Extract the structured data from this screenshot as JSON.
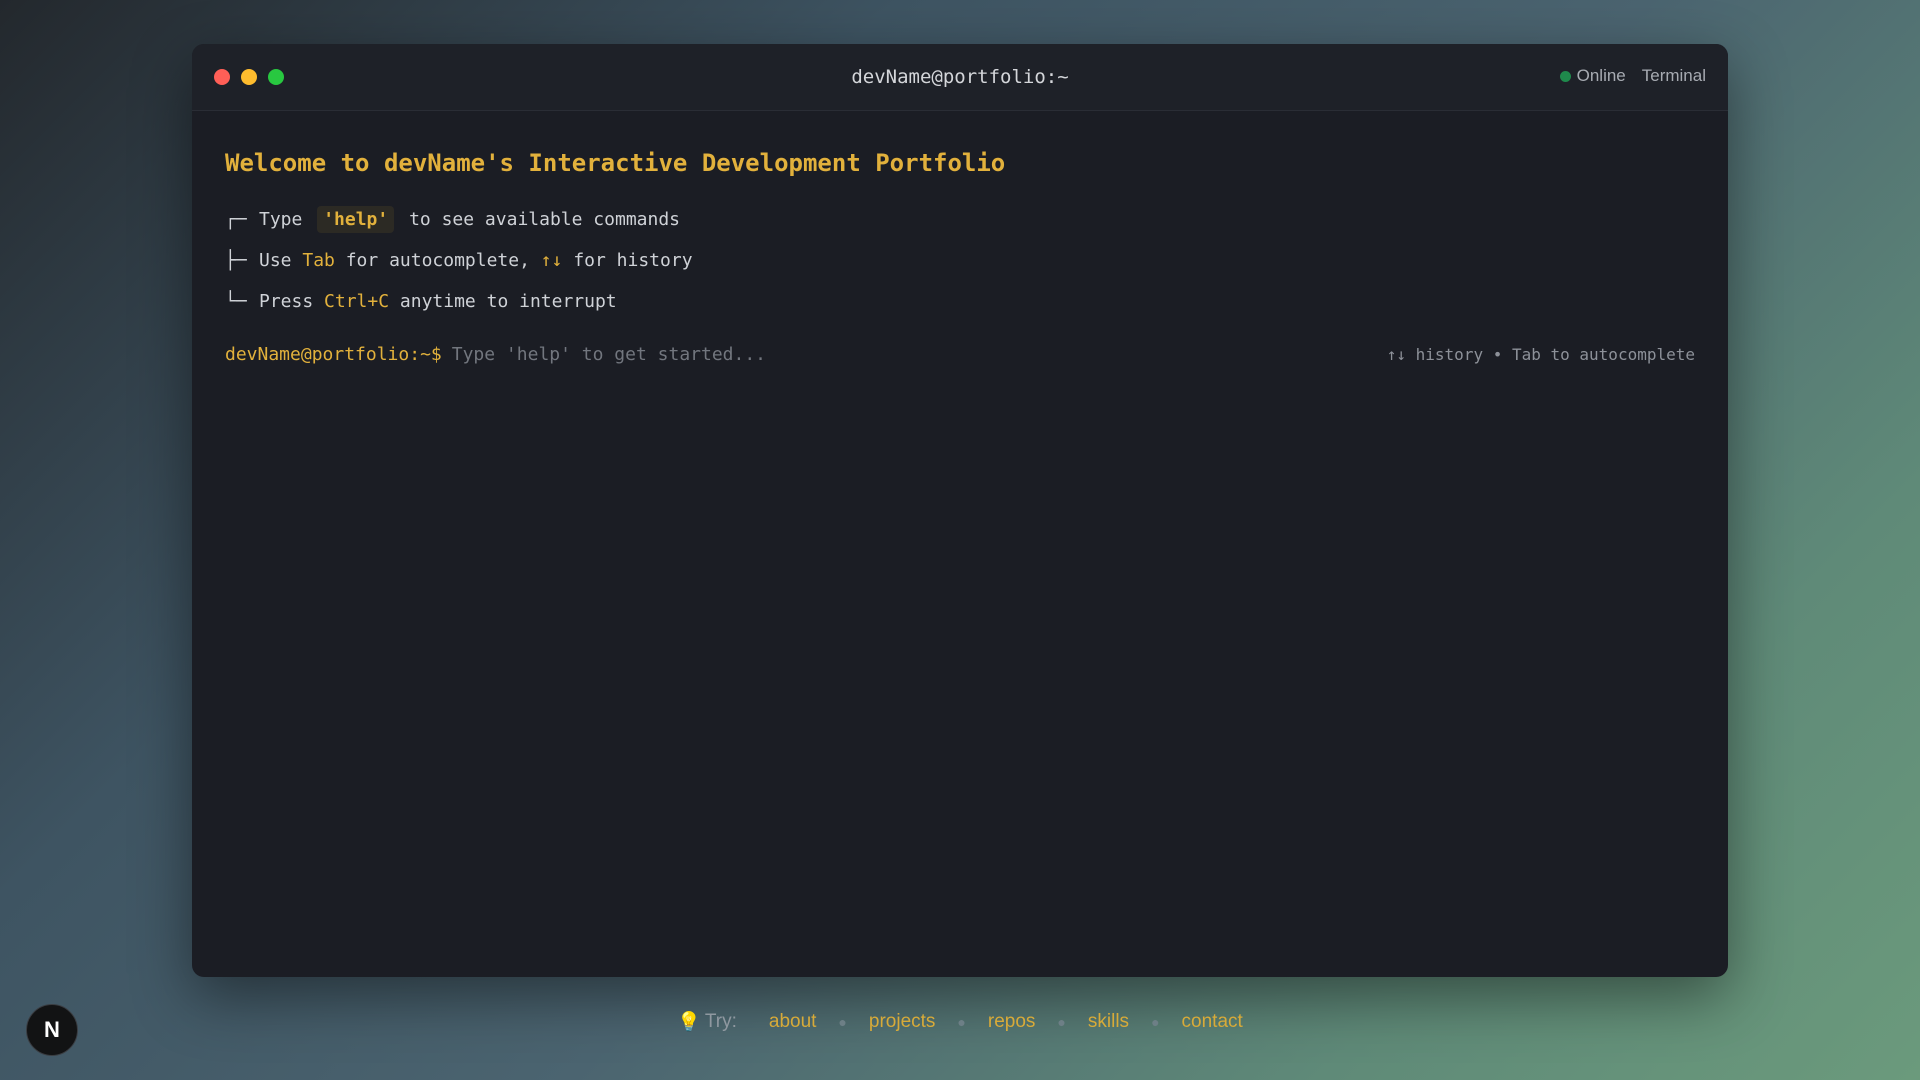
{
  "window": {
    "title": "devName@portfolio:~",
    "status_label": "Online",
    "app_label": "Terminal"
  },
  "welcome": {
    "heading": "Welcome to devName's Interactive Development Portfolio"
  },
  "tips": [
    {
      "prefix": "┌─",
      "before": "Type",
      "key": "'help'",
      "after": "to see available commands"
    },
    {
      "prefix": "├─",
      "before": "Use",
      "key": "Tab",
      "middle": "for autocomplete,",
      "key2": "↑↓",
      "after": "for history"
    },
    {
      "prefix": "└─",
      "before": "Press",
      "key": "Ctrl+C",
      "after": "anytime to interrupt"
    }
  ],
  "prompt": {
    "text": "devName@portfolio:~$",
    "placeholder": "Type 'help' to get started...",
    "hint": "↑↓ history • Tab to autocomplete"
  },
  "suggestions": {
    "icon": "lightbulb-icon",
    "label": "Try:",
    "commands": [
      "about",
      "projects",
      "repos",
      "skills",
      "contact"
    ]
  },
  "logo": {
    "letter": "N"
  },
  "colors": {
    "accent": "#e2b13c",
    "online": "#1f8a4c",
    "terminal_bg": "#1b1d24"
  }
}
